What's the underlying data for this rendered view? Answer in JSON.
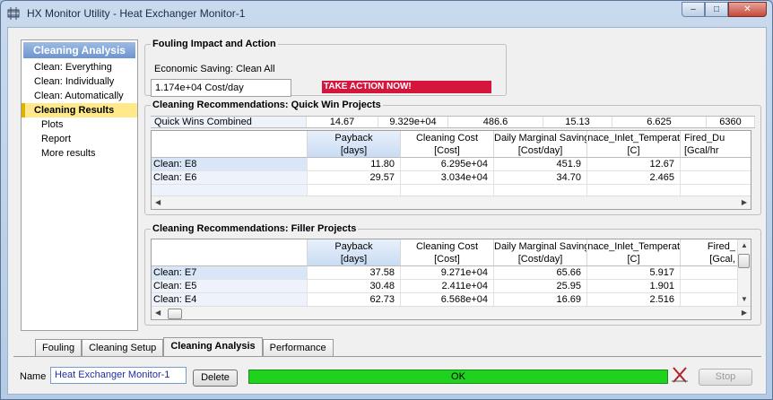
{
  "window": {
    "title": "HX Monitor Utility - Heat Exchanger Monitor-1",
    "controls": {
      "minimize": "–",
      "maximize": "□",
      "close": "✕"
    }
  },
  "nav": {
    "header": "Cleaning Analysis",
    "items": [
      {
        "label": "Clean: Everything",
        "level": 0,
        "selected": false
      },
      {
        "label": "Clean: Individually",
        "level": 0,
        "selected": false
      },
      {
        "label": "Clean: Automatically",
        "level": 0,
        "selected": false
      },
      {
        "label": "Cleaning Results",
        "level": 0,
        "selected": true
      },
      {
        "label": "Plots",
        "level": 1,
        "selected": false
      },
      {
        "label": "Report",
        "level": 1,
        "selected": false
      },
      {
        "label": "More results",
        "level": 1,
        "selected": false
      }
    ]
  },
  "fouling": {
    "group_label": "Fouling Impact and Action",
    "economic_label": "Economic Saving: Clean All",
    "economic_value": "1.174e+04 Cost/day",
    "action_text": "TAKE ACTION NOW!",
    "action_color": "#d6153d"
  },
  "quick_wins": {
    "group_label": "Cleaning Recommendations: Quick Win Projects",
    "combined": {
      "label": "Quick Wins Combined",
      "values": [
        "14.67",
        "9.329e+04",
        "486.6",
        "15.13",
        "6.625",
        "6360"
      ]
    },
    "columns": [
      {
        "line1": "",
        "line2": ""
      },
      {
        "line1": "Payback",
        "line2": "[days]"
      },
      {
        "line1": "Cleaning Cost",
        "line2": "[Cost]"
      },
      {
        "line1": "Daily Marginal Saving",
        "line2": "[Cost/day]"
      },
      {
        "line1": "Furnace_Inlet_Temperat",
        "line2": "[C]"
      },
      {
        "line1": "Fired_Du",
        "line2": "[Gcal/hr"
      }
    ],
    "rows": [
      {
        "name": "Clean: E8",
        "values": [
          "11.80",
          "6.295e+04",
          "451.9",
          "12.67",
          ""
        ]
      },
      {
        "name": "Clean: E6",
        "values": [
          "29.57",
          "3.034e+04",
          "34.70",
          "2.465",
          ""
        ]
      }
    ]
  },
  "filler": {
    "group_label": "Cleaning Recommendations: Filler Projects",
    "columns": [
      {
        "line1": "",
        "line2": ""
      },
      {
        "line1": "Payback",
        "line2": "[days]"
      },
      {
        "line1": "Cleaning Cost",
        "line2": "[Cost]"
      },
      {
        "line1": "Daily Marginal Saving",
        "line2": "[Cost/day]"
      },
      {
        "line1": "Furnace_Inlet_Temperat",
        "line2": "[C]"
      },
      {
        "line1": "Fired_",
        "line2": "[Gcal,"
      }
    ],
    "rows": [
      {
        "name": "Clean: E7",
        "values": [
          "37.58",
          "9.271e+04",
          "65.66",
          "5.917",
          ""
        ]
      },
      {
        "name": "Clean: E5",
        "values": [
          "30.48",
          "2.411e+04",
          "25.95",
          "1.901",
          ""
        ]
      },
      {
        "name": "Clean: E4",
        "values": [
          "62.73",
          "6.568e+04",
          "16.69",
          "2.516",
          ""
        ]
      }
    ]
  },
  "tabs": [
    {
      "label": "Fouling",
      "active": false
    },
    {
      "label": "Cleaning Setup",
      "active": false
    },
    {
      "label": "Cleaning Analysis",
      "active": true
    },
    {
      "label": "Performance",
      "active": false
    }
  ],
  "footer": {
    "name_label": "Name",
    "name_value": "Heat Exchanger Monitor-1",
    "delete_label": "Delete",
    "status_text": "OK",
    "status_progress": 1.0,
    "status_color": "#1ed21e",
    "stop_label": "Stop"
  }
}
